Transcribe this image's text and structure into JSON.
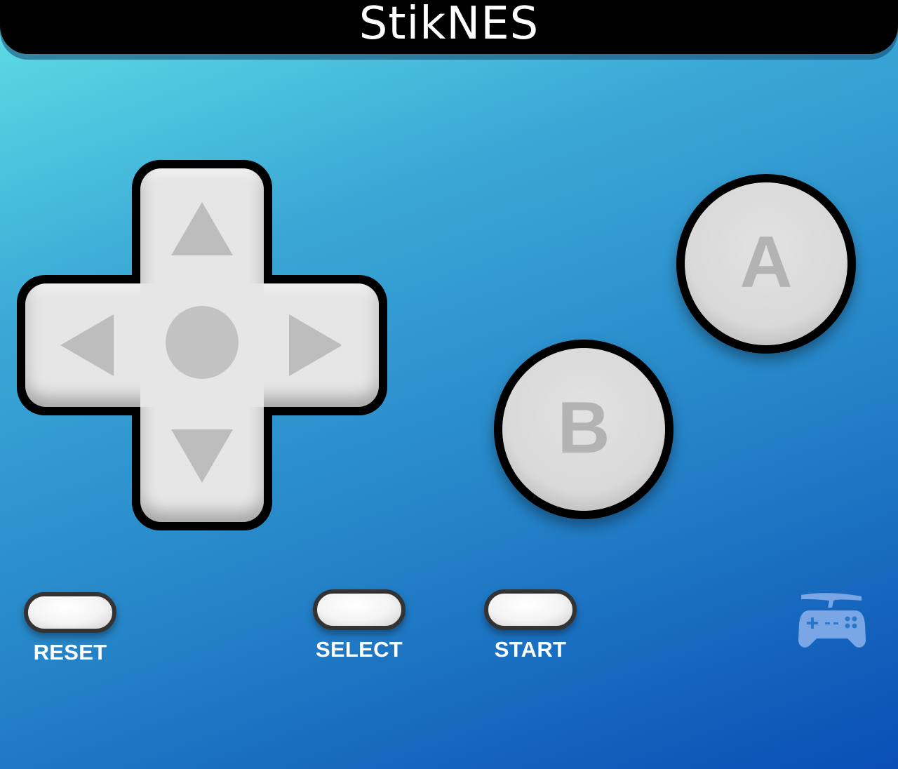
{
  "app": {
    "title": "StikNES"
  },
  "buttons": {
    "a_label": "A",
    "b_label": "B",
    "reset_label": "RESET",
    "select_label": "SELECT",
    "start_label": "START"
  },
  "dpad": {
    "directions": [
      "up",
      "down",
      "left",
      "right"
    ]
  },
  "icons": {
    "up": "triangle-up-icon",
    "down": "triangle-down-icon",
    "left": "triangle-left-icon",
    "right": "triangle-right-icon",
    "controller": "gamepad-icon"
  },
  "colors": {
    "background_start": "#5fdfe6",
    "background_end": "#0a4fb5",
    "header": "#000000",
    "button_face": "#e6e6e6",
    "button_glyph": "#b3b3b3",
    "label": "#ffffff",
    "controller_icon": "#7aa6e6"
  }
}
